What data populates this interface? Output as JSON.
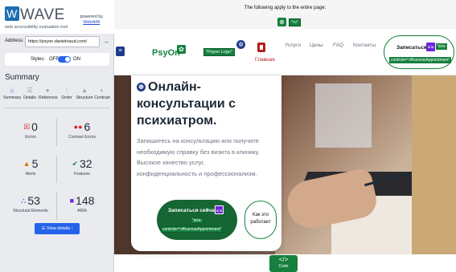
{
  "wave": {
    "logo": "WAVE",
    "tagline": "web accessibility evaluation tool",
    "powered_by": "powered by",
    "webaim": "WebAIM",
    "address_label": "Address:",
    "address_value": "https://psyon.danielnaud.com/",
    "styles_label": "Styles:",
    "off": "OFF",
    "on": "ON",
    "summary_title": "Summary",
    "tabs": [
      {
        "label": "Summary",
        "icon": "home-icon"
      },
      {
        "label": "Details",
        "icon": "list-icon"
      },
      {
        "label": "Reference",
        "icon": "info-icon"
      },
      {
        "label": "Order",
        "icon": "order-icon"
      },
      {
        "label": "Structure",
        "icon": "structure-icon"
      },
      {
        "label": "Contrast",
        "icon": "contrast-icon"
      }
    ],
    "stats": {
      "errors": {
        "value": "0",
        "label": "Errors"
      },
      "contrast_errors": {
        "value": "6",
        "label": "Contrast Errors"
      },
      "alerts": {
        "value": "5",
        "label": "Alerts"
      },
      "features": {
        "value": "32",
        "label": "Features"
      },
      "structural": {
        "value": "53",
        "label": "Structural Elements"
      },
      "aria": {
        "value": "148",
        "label": "ARIA"
      }
    },
    "view_details": "View details ›"
  },
  "page": {
    "topbar_text": "The following apply to the entire page:",
    "topbar_lang": "\"ru\"",
    "brand": "PsyOn",
    "logo_alt": "\"Psyon Logo\"",
    "home_label": "Главная",
    "nav": [
      "Услуги",
      "Цены",
      "FAQ",
      "Контакты"
    ],
    "cta_top_label": "Записаться",
    "aria_badge": "aria",
    "aria_text": "\"aria-",
    "aria_controls": "controls=\"offcanvasAppointment\"",
    "hero_title": "Онлайн-консультации с психиатром.",
    "hero_text": "Запишитесь на консультацию или получите необходимую справку без визита в клинику. Высокое качество услуг, конфиденциальность и профессионализм.",
    "hero_cta": "Записаться сейчас",
    "how_it_works": "Как это работает",
    "code_label": "Code"
  },
  "colors": {
    "wave_blue": "#2563eb",
    "green": "#15803d",
    "aria_purple": "#6d28d9",
    "error_red": "#b91c1c"
  }
}
